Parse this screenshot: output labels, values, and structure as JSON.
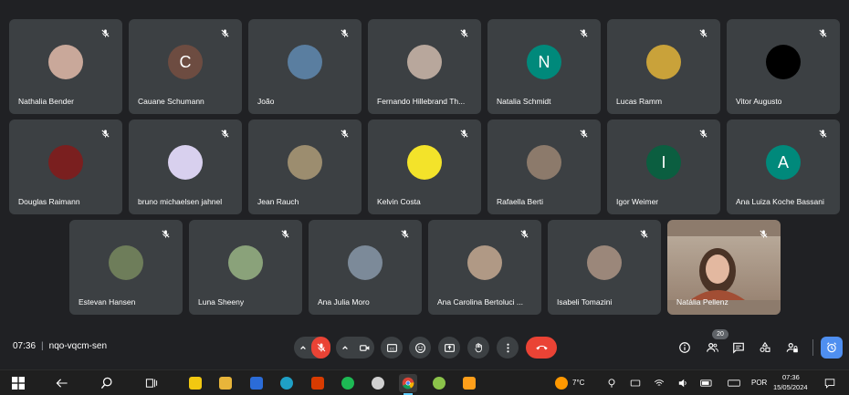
{
  "participants": [
    {
      "name": "Nathalia Bender",
      "avatar_color": "#c9a89a"
    },
    {
      "name": "Cauane Schumann",
      "avatar_color": "#6d4c41",
      "initial": "C"
    },
    {
      "name": "João",
      "avatar_color": "#5a7ea0"
    },
    {
      "name": "Fernando Hillebrand Th...",
      "avatar_color": "#b8a79c"
    },
    {
      "name": "Natalia Schmidt",
      "avatar_color": "#00897b",
      "initial": "N"
    },
    {
      "name": "Lucas Ramm",
      "avatar_color": "#c9a23a"
    },
    {
      "name": "Vitor Augusto",
      "avatar_color": "#000000"
    },
    {
      "name": "Douglas Raimann",
      "avatar_color": "#7a1f1f"
    },
    {
      "name": "bruno michaelsen jahnel",
      "avatar_color": "#d8d0ee"
    },
    {
      "name": "Jean Rauch",
      "avatar_color": "#9c8d6f"
    },
    {
      "name": "Kelvin Costa",
      "avatar_color": "#f3e32a"
    },
    {
      "name": "Rafaella Berti",
      "avatar_color": "#8c7a6b"
    },
    {
      "name": "Igor Weimer",
      "avatar_color": "#0b5e40",
      "initial": "I"
    },
    {
      "name": "Ana Luiza Koche Bassani",
      "avatar_color": "#00897b",
      "initial": "A"
    },
    {
      "name": "Estevan Hansen",
      "avatar_color": "#6e7d5a"
    },
    {
      "name": "Luna Sheeny",
      "avatar_color": "#8aa27a"
    },
    {
      "name": "Ana Julia Moro",
      "avatar_color": "#7c8a99"
    },
    {
      "name": "Ana Carolina Bertoluci ...",
      "avatar_color": "#b09985"
    },
    {
      "name": "Isabeli Tomazini",
      "avatar_color": "#9b877a"
    },
    {
      "name": "Natália Pellenz",
      "video": true
    }
  ],
  "meeting": {
    "time": "07:36",
    "separator": "|",
    "code": "nqo-vqcm-sen"
  },
  "people_count": "20",
  "colors": {
    "background": "#202124",
    "tile": "#3c4043",
    "danger": "#ea4335",
    "activities_blue": "#4f8ff0"
  },
  "controls": [
    {
      "name": "microphone-off",
      "icon": "mic-off-icon"
    },
    {
      "name": "camera",
      "icon": "camera-icon"
    },
    {
      "name": "captions",
      "icon": "cc-icon"
    },
    {
      "name": "emoji",
      "icon": "emoji-icon"
    },
    {
      "name": "present",
      "icon": "present-icon"
    },
    {
      "name": "raise-hand",
      "icon": "hand-icon"
    },
    {
      "name": "more-options",
      "icon": "more-vert-icon"
    },
    {
      "name": "leave-call",
      "icon": "phone-hangup-icon"
    }
  ],
  "taskbar": {
    "weather": "7°C",
    "language": "POR",
    "clock_time": "07:36",
    "clock_date": "15/05/2024"
  }
}
